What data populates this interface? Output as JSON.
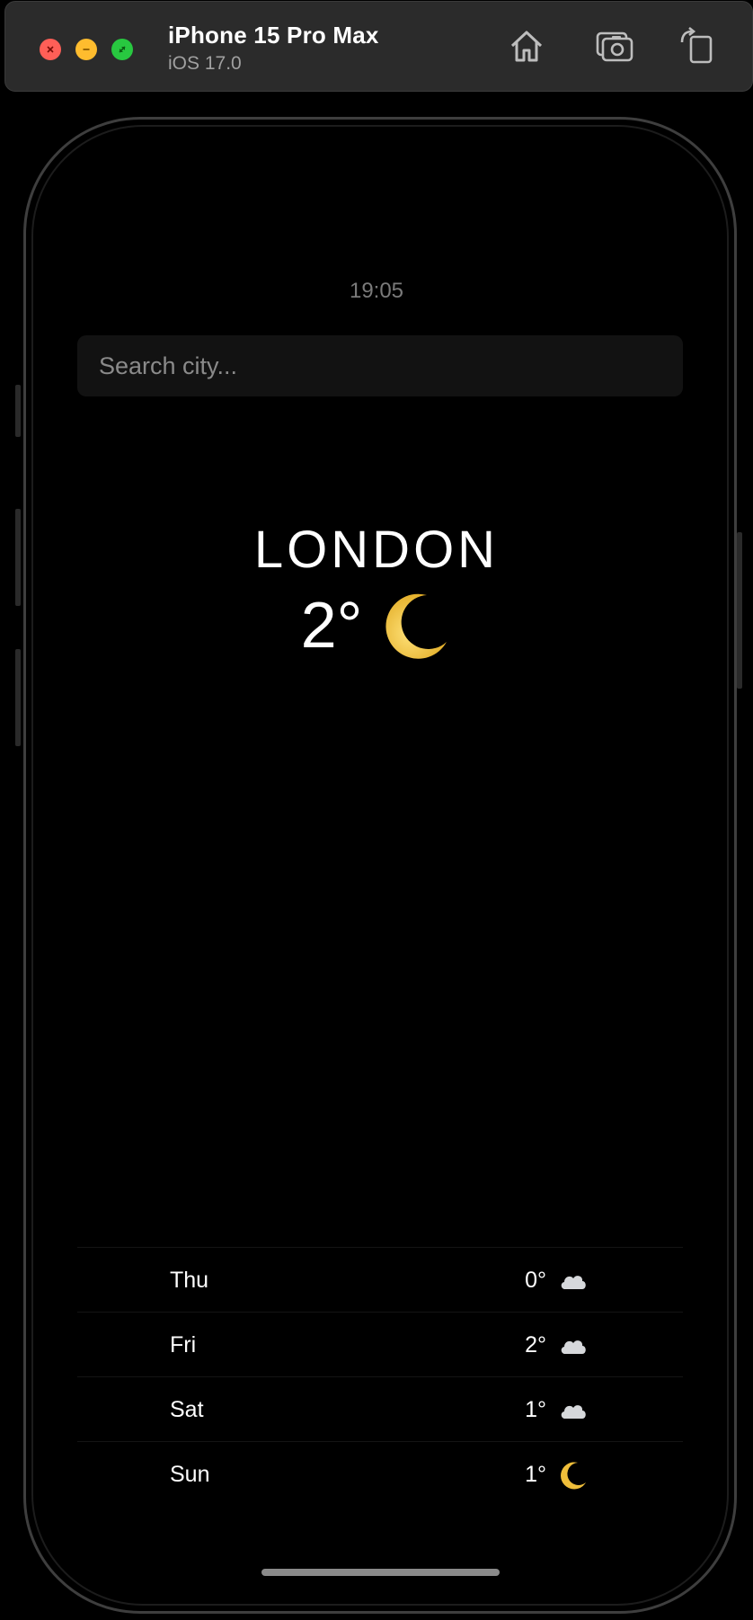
{
  "simulator": {
    "device_name": "iPhone 15 Pro Max",
    "os_version": "iOS 17.0",
    "toolbar": [
      "home-icon",
      "screenshot-icon",
      "rotate-icon"
    ]
  },
  "app": {
    "time": "19:05",
    "search": {
      "placeholder": "Search city...",
      "value": ""
    },
    "city": "LONDON",
    "current_temp": "2°",
    "current_icon": "crescent-moon-icon",
    "forecast": [
      {
        "day": "Thu",
        "temp": "0°",
        "icon": "cloud-icon"
      },
      {
        "day": "Fri",
        "temp": "2°",
        "icon": "cloud-icon"
      },
      {
        "day": "Sat",
        "temp": "1°",
        "icon": "cloud-icon"
      },
      {
        "day": "Sun",
        "temp": "1°",
        "icon": "crescent-moon-icon"
      }
    ]
  },
  "colors": {
    "background": "#000000",
    "close": "#ff5f57",
    "minimize": "#febc2e",
    "zoom": "#28c840",
    "moon": "#f2c94c"
  }
}
